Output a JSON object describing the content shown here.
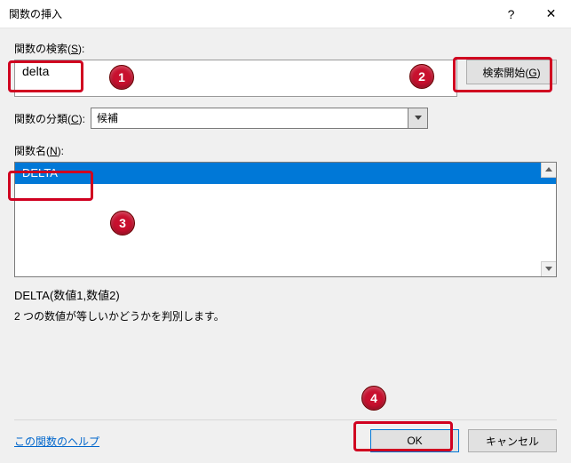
{
  "titlebar": {
    "title": "関数の挿入"
  },
  "search": {
    "label_pre": "関数の検索(",
    "label_key": "S",
    "label_post": "):",
    "value": "delta",
    "button_pre": "検索開始(",
    "button_key": "G",
    "button_post": ")"
  },
  "category": {
    "label_pre": "関数の分類(",
    "label_key": "C",
    "label_post": "):",
    "selected": "候補"
  },
  "func_list": {
    "label_pre": "関数名(",
    "label_key": "N",
    "label_post": "):",
    "items": [
      "DELTA"
    ]
  },
  "detail": {
    "signature": "DELTA(数値1,数値2)",
    "description": "2 つの数値が等しいかどうかを判別します。"
  },
  "footer": {
    "help": "この関数のヘルプ",
    "ok": "OK",
    "cancel": "キャンセル"
  },
  "annotations": {
    "b1": "1",
    "b2": "2",
    "b3": "3",
    "b4": "4"
  }
}
